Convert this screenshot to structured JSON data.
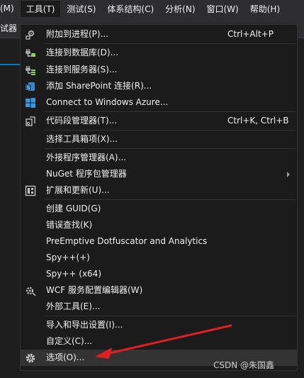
{
  "menubar": {
    "items": [
      {
        "label": "(M)"
      },
      {
        "label": "工具(T)"
      },
      {
        "label": "测试(S)"
      },
      {
        "label": "体系结构(C)"
      },
      {
        "label": "分析(N)"
      },
      {
        "label": "窗口(W)"
      },
      {
        "label": "帮助(H)"
      }
    ]
  },
  "toolbar": {
    "fragment": "试器"
  },
  "menu": {
    "items": [
      {
        "label": "附加到进程(P)...",
        "shortcut": "Ctrl+Alt+P",
        "icon": "attach-process-icon"
      },
      {
        "label": "连接到数据库(D)...",
        "icon": "database-connect-icon"
      },
      {
        "label": "连接到服务器(S)...",
        "icon": "server-connect-icon"
      },
      {
        "label": "添加 SharePoint 连接(R)...",
        "icon": "sharepoint-icon"
      },
      {
        "label": "Connect to Windows Azure...",
        "icon": "windows-azure-icon"
      },
      {
        "label": "代码段管理器(T)...",
        "shortcut": "Ctrl+K, Ctrl+B",
        "icon": "code-snippet-icon"
      },
      {
        "label": "选择工具箱项(X)..."
      },
      {
        "label": "外接程序管理器(A)..."
      },
      {
        "label": "NuGet 程序包管理器",
        "submenu": true
      },
      {
        "label": "扩展和更新(U)...",
        "icon": "extensions-icon"
      },
      {
        "label": "创建 GUID(G)"
      },
      {
        "label": "错误查找(K)"
      },
      {
        "label": "PreEmptive Dotfuscator and Analytics"
      },
      {
        "label": "Spy++(+)"
      },
      {
        "label": "Spy++ (x64)"
      },
      {
        "label": "WCF 服务配置编辑器(W)",
        "icon": "wcf-config-icon"
      },
      {
        "label": "外部工具(E)..."
      },
      {
        "label": "导入和导出设置(I)..."
      },
      {
        "label": "自定义(C)..."
      },
      {
        "label": "选项(O)...",
        "icon": "gear-icon"
      }
    ]
  },
  "watermark": "CSDN @朱国鑫",
  "colors": {
    "background": "#1e1e1e",
    "menu": "#1b1b1c",
    "accent": "#007acc",
    "annotation": "#e02020"
  }
}
